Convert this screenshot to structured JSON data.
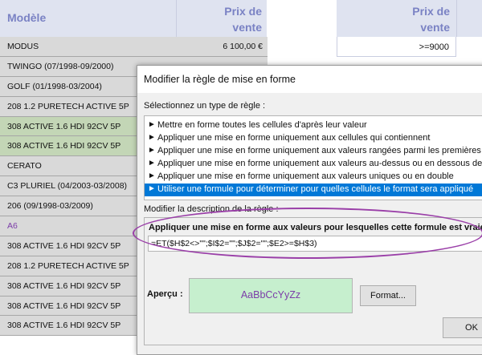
{
  "sheet": {
    "header_model": "Modèle",
    "header_price": "Prix de\nvente",
    "header_price_right": "Prix de\nvente",
    "right_cell": ">=9000",
    "rows": [
      {
        "model": "MODUS",
        "price": "6 100,00 €",
        "highlight": "none"
      },
      {
        "model": "TWINGO (07/1998-09/2000)",
        "price": "",
        "highlight": "none"
      },
      {
        "model": "GOLF (01/1998-03/2004)",
        "price": "",
        "highlight": "none"
      },
      {
        "model": "208 1.2 PURETECH ACTIVE 5P",
        "price": "",
        "highlight": "none"
      },
      {
        "model": "308 ACTIVE 1.6 HDI 92CV 5P",
        "price": "",
        "highlight": "green"
      },
      {
        "model": "308 ACTIVE 1.6 HDI 92CV 5P",
        "price": "",
        "highlight": "green"
      },
      {
        "model": "CERATO",
        "price": "",
        "highlight": "none"
      },
      {
        "model": "C3 PLURIEL (04/2003-03/2008)",
        "price": "",
        "highlight": "none"
      },
      {
        "model": "206 (09/1998-03/2009)",
        "price": "",
        "highlight": "none"
      },
      {
        "model": "A6",
        "price": "",
        "highlight": "purple"
      },
      {
        "model": "308 ACTIVE 1.6 HDI 92CV 5P",
        "price": "",
        "highlight": "none"
      },
      {
        "model": "208 1.2 PURETECH ACTIVE 5P",
        "price": "",
        "highlight": "none"
      },
      {
        "model": "308 ACTIVE 1.6 HDI 92CV 5P",
        "price": "",
        "highlight": "none"
      },
      {
        "model": "308 ACTIVE 1.6 HDI 92CV 5P",
        "price": "",
        "highlight": "none"
      },
      {
        "model": "308 ACTIVE 1.6 HDI 92CV 5P",
        "price": "",
        "highlight": "none"
      }
    ]
  },
  "dialog": {
    "title": "Modifier la règle de mise en forme",
    "select_type_label": "Sélectionnez un type de règle :",
    "rule_types": [
      "Mettre en forme toutes les cellules d'après leur valeur",
      "Appliquer une mise en forme uniquement aux cellules qui contiennent",
      "Appliquer une mise en forme uniquement aux valeurs rangées parmi les premières ou",
      "Appliquer une mise en forme uniquement aux valeurs au-dessus ou en dessous de la",
      "Appliquer une mise en forme uniquement aux valeurs uniques ou en double",
      "Utiliser une formule pour déterminer pour quelles cellules le format sera appliqué"
    ],
    "selected_rule_index": 5,
    "arrow_glyph": "►",
    "edit_desc_label": "Modifier la description de la règle :",
    "formula_heading": "Appliquer une mise en forme aux valeurs pour lesquelles cette formule est vraie",
    "formula": "=ET($H$2<>\"\";$I$2=\"\";$J$2=\"\";$E2>=$H$3)",
    "preview_label": "Aperçu :",
    "preview_text": "AaBbCcYyZz",
    "format_button": "Format...",
    "ok_button": "OK"
  },
  "colors": {
    "header_bg": "#dfe3f0",
    "header_text": "#7a82c4",
    "row_gray": "#d9d9d9",
    "row_green": "#c3d6b6",
    "purple_text": "#7b3ca8",
    "selection_blue": "#0078d7",
    "preview_bg": "#c6efce",
    "annotation_oval": "#9a3fa8"
  }
}
